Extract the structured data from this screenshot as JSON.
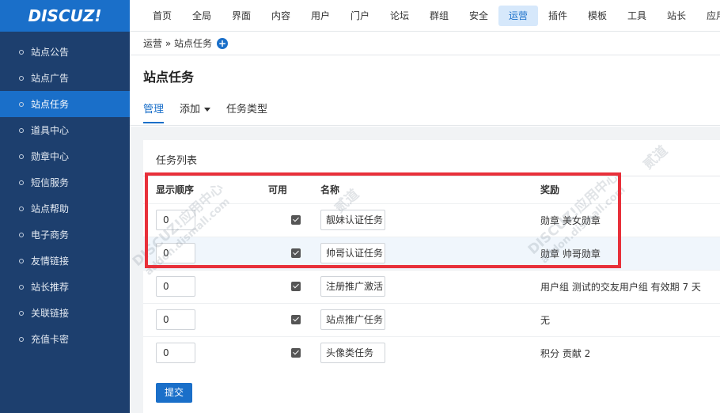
{
  "logo": "DISCUZ!",
  "sidebar": {
    "items": [
      {
        "label": "站点公告"
      },
      {
        "label": "站点广告"
      },
      {
        "label": "站点任务"
      },
      {
        "label": "道具中心"
      },
      {
        "label": "勋章中心"
      },
      {
        "label": "短信服务"
      },
      {
        "label": "站点帮助"
      },
      {
        "label": "电子商务"
      },
      {
        "label": "友情链接"
      },
      {
        "label": "站长推荐"
      },
      {
        "label": "关联链接"
      },
      {
        "label": "充值卡密"
      }
    ],
    "active_index": 2
  },
  "topnav": {
    "items": [
      "首页",
      "全局",
      "界面",
      "内容",
      "用户",
      "门户",
      "论坛",
      "群组",
      "安全",
      "运营",
      "插件",
      "模板",
      "工具",
      "站长",
      "应用"
    ],
    "active_index": 9
  },
  "breadcrumb": {
    "text": "运营 » 站点任务",
    "plus": "+"
  },
  "page": {
    "title": "站点任务"
  },
  "tabs": {
    "manage": "管理",
    "add": "添加",
    "types": "任务类型"
  },
  "panel": {
    "title": "任务列表",
    "headers": {
      "order": "显示顺序",
      "enabled": "可用",
      "name": "名称",
      "reward": "奖励"
    },
    "rows": [
      {
        "order": "0",
        "name": "靓妹认证任务",
        "reward": "勋章 美女勋章",
        "enabled": true
      },
      {
        "order": "0",
        "name": "帅哥认证任务",
        "reward": "勋章 帅哥勋章",
        "enabled": true
      },
      {
        "order": "0",
        "name": "注册推广激活",
        "reward": "用户组 测试的交友用户组 有效期 7 天",
        "enabled": true
      },
      {
        "order": "0",
        "name": "站点推广任务",
        "reward": "无",
        "enabled": true
      },
      {
        "order": "0",
        "name": "头像类任务",
        "reward": "积分 贡献 2",
        "enabled": true
      }
    ],
    "submit": "提交"
  },
  "watermark": {
    "line1": "DISCUZ!应用中心",
    "line2": "addon.dismall.com",
    "brand": "贰道"
  },
  "colors": {
    "accent": "#1a6fc9",
    "sidebar": "#1d3f6e",
    "highlight_box": "#e8303a"
  }
}
